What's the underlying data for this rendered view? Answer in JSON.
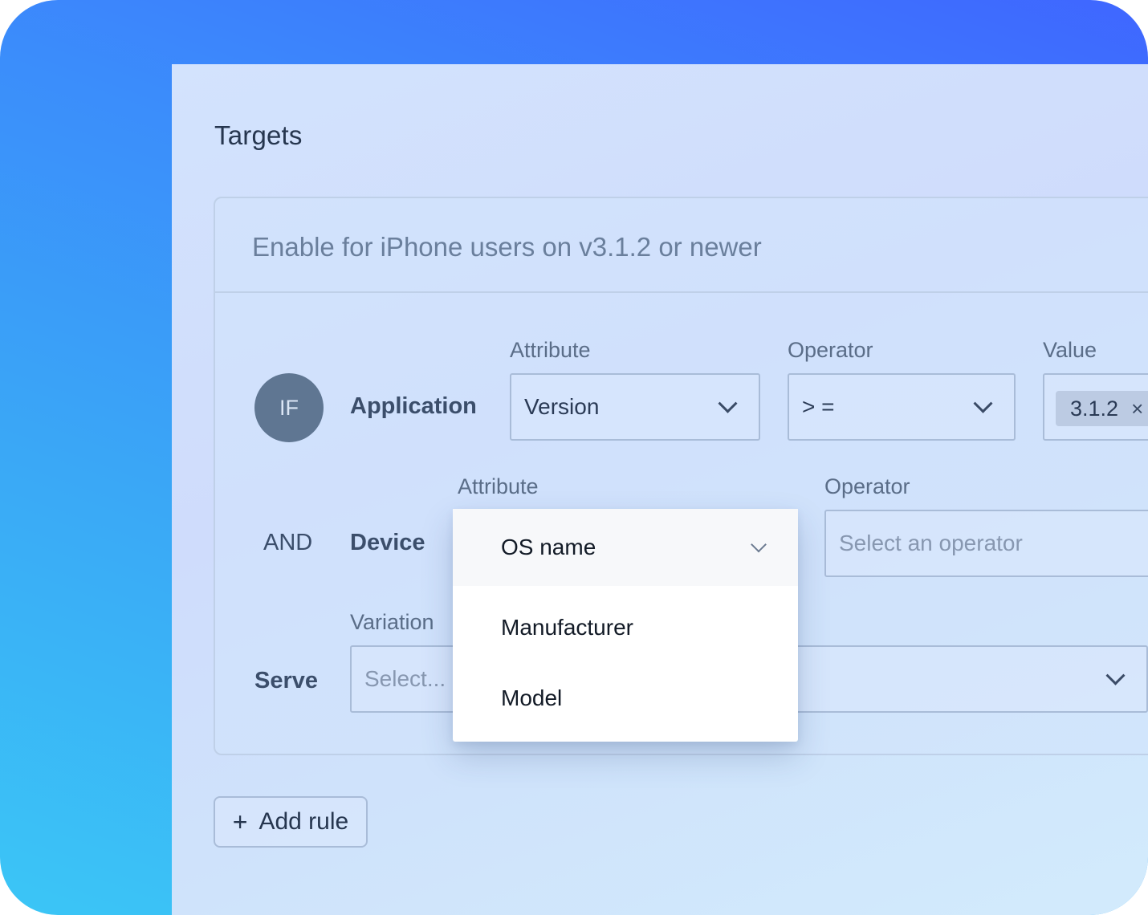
{
  "title": "Targets",
  "rule": {
    "description": "Enable for iPhone users on v3.1.2 or newer",
    "condition1": {
      "prefix": "IF",
      "category": "Application",
      "attribute_label": "Attribute",
      "attribute_value": "Version",
      "operator_label": "Operator",
      "operator_value": "> =",
      "value_label": "Value",
      "value_chip": "3.1.2",
      "remove_symbol": "×"
    },
    "condition2": {
      "prefix": "AND",
      "category": "Device",
      "attribute_label": "Attribute",
      "attribute_value": "OS name",
      "operator_label": "Operator",
      "operator_placeholder": "Select an operator"
    },
    "serve": {
      "label": "Serve",
      "variation_label": "Variation",
      "variation_placeholder": "Select..."
    }
  },
  "dropdown_options": [
    "Manufacturer",
    "Model"
  ],
  "add_rule": {
    "plus": "+",
    "label": "Add rule"
  }
}
